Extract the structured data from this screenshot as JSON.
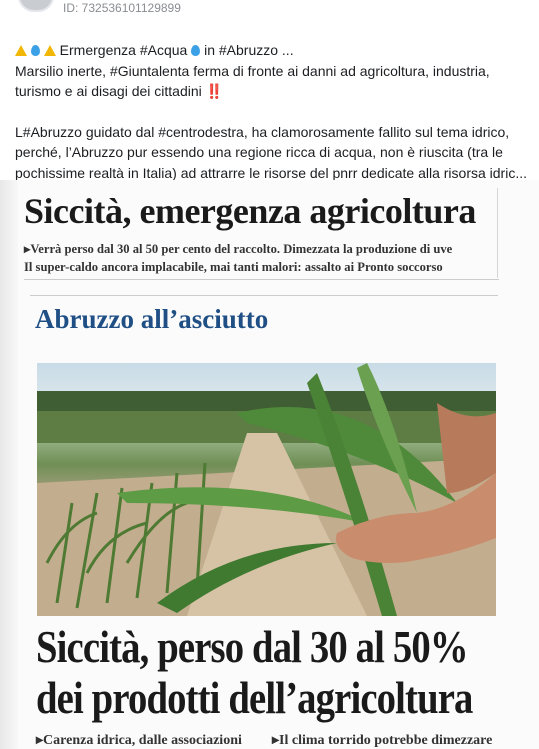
{
  "post": {
    "id_label": "ID: 732536101129899",
    "title_line": "Ermergenza #Acqua",
    "title_mid": "in #Abruzzo ...",
    "line2": "Marsilio inerte, #Giuntalenta ferma di fronte ai danni ad agricoltura, industria,",
    "line3": "turismo e ai disagi dei cittadini ‼️",
    "line5": "L#Abruzzo guidato dal #centrodestra, ha clamorosamente fallito sul tema idrico,",
    "line6": "perché, l’Abruzzo pur essendo una regione ricca di acqua, non è riuscita (tra le",
    "line7": "pochissime realtà in Italia) ad attrarre le risorse del pnrr dedicate alla risorsa idric..."
  },
  "clipping": {
    "headline1": "Siccità, emergenza agricoltura",
    "sub1": "▸Verrà perso dal 30 al 50 per cento del raccolto. Dimezzata la produzione di uve",
    "sub2": "Il super-caldo ancora implacabile, mai tanti malori: assalto ai Pronto soccorso",
    "section_title": "Abruzzo all’asciutto",
    "headline2": "Siccità, perso dal 30 al 50%",
    "headline3": "dei prodotti dell’agricoltura",
    "col1": "▸Carenza idrica, dalle associazioni",
    "col2": "▸Il clima torrido potrebbe dimezzare"
  },
  "icons": [
    "warning-emoji",
    "droplet-emoji"
  ],
  "colors": {
    "section_title": "#1f4f84",
    "id_text": "#8a8d91"
  }
}
